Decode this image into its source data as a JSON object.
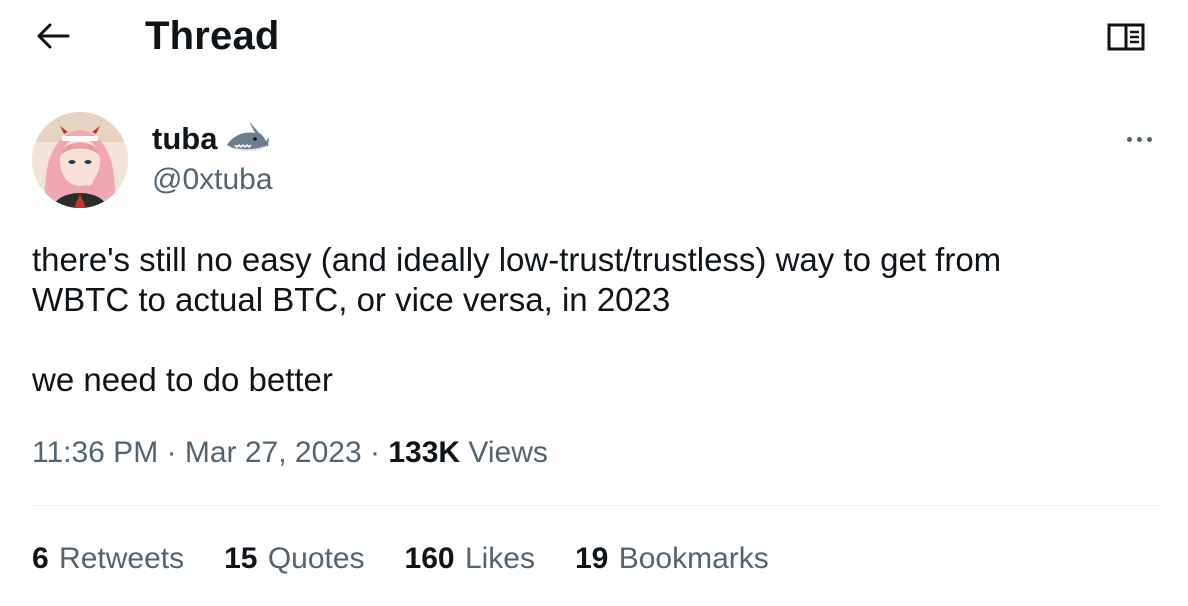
{
  "header": {
    "title": "Thread",
    "back_icon": "arrow-left-icon",
    "reader_icon": "open-book-icon"
  },
  "tweet": {
    "author": {
      "display_name": "tuba",
      "name_emoji": "shark-icon",
      "handle": "@0xtuba"
    },
    "text_lines": [
      "there's still no easy (and ideally low-trust/trustless) way to get from",
      "WBTC to actual BTC, or vice versa, in 2023",
      "we need to do better"
    ],
    "time": "11:36 PM",
    "separator": "·",
    "date": "Mar 27, 2023",
    "views_count": "133K",
    "views_label": "Views",
    "stats": [
      {
        "count": "6",
        "label": "Retweets"
      },
      {
        "count": "15",
        "label": "Quotes"
      },
      {
        "count": "160",
        "label": "Likes"
      },
      {
        "count": "19",
        "label": "Bookmarks"
      }
    ]
  },
  "colors": {
    "text_primary": "#0f1419",
    "text_secondary": "#536471",
    "divider": "#eff3f4"
  }
}
